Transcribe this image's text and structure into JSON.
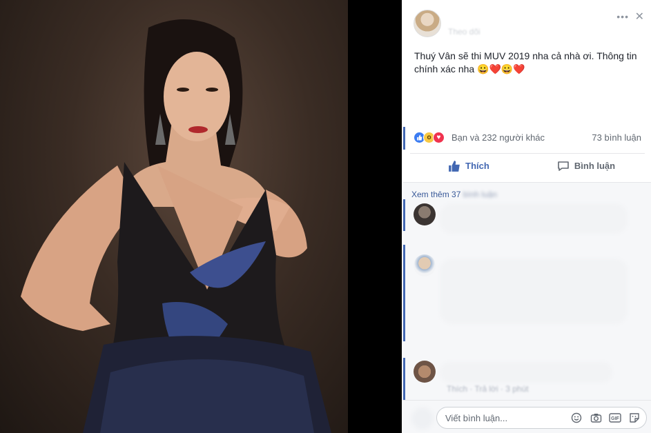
{
  "post": {
    "follow_label": "Theo dõi",
    "text": "Thuý Vân sẽ thi MUV 2019 nha cả nhà ơi. Thông tin chính xác nha 😀❤️😀❤️"
  },
  "reactions": {
    "icons": [
      "like-icon",
      "wow-icon",
      "love-icon"
    ],
    "summary": "Bạn và 232 người khác",
    "comment_count": "73 bình luận"
  },
  "actions": {
    "like_label": "Thích",
    "comment_label": "Bình luận"
  },
  "comments": {
    "see_more_prefix": "Xem thêm 37",
    "see_more_blurred": "bình luận",
    "last_comment_meta": "Thích · Trả lời · 3 phút"
  },
  "composer": {
    "placeholder": "Viết bình luận..."
  },
  "colors": {
    "accent": "#4267b2",
    "link": "#385898",
    "like": "#3b7cf2",
    "love": "#f0334f",
    "wow": "#f7c843"
  }
}
